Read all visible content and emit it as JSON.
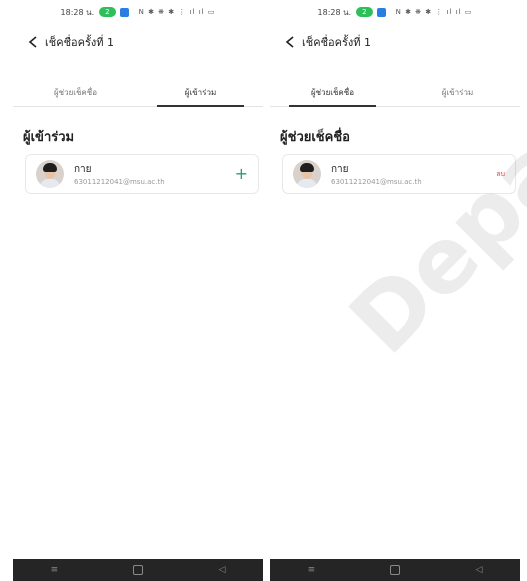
{
  "status": {
    "time": "18:28 น.",
    "call_label": "2",
    "icons": "N ✱ ❋ ✱ ⋮ ıl ıl ▭"
  },
  "header": {
    "title": "เช็คชื่อครั้งที่ 1"
  },
  "tabs": {
    "assistant": "ผู้ช่วยเช็คชื่อ",
    "participant": "ผู้เข้าร่วม"
  },
  "left": {
    "section_title": "ผู้เข้าร่วม",
    "person": {
      "name": "กาย",
      "email": "63011212041@msu.ac.th"
    },
    "action": "+"
  },
  "right": {
    "section_title": "ผู้ช่วยเช็คชื่อ",
    "person": {
      "name": "กาย",
      "email": "63011212041@msu.ac.th"
    },
    "action": "ลบ"
  },
  "nav": {
    "menu": "≡",
    "home": "",
    "back": "◁"
  },
  "watermark": "Depart"
}
